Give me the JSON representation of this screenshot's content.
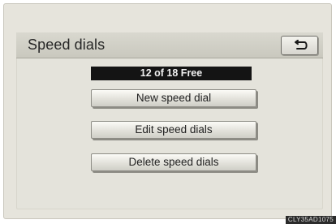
{
  "window": {
    "title": "Speed dials",
    "back_icon": "back-arrow-icon"
  },
  "status": {
    "text": "12 of 18 Free"
  },
  "menu": {
    "new_label": "New speed dial",
    "edit_label": "Edit speed dials",
    "delete_label": "Delete speed dials"
  },
  "footer": {
    "code": "CLY35AD1075"
  },
  "colors": {
    "screen_bg": "#e4e3db",
    "status_bg": "#141414",
    "status_text": "#f0f0f0"
  }
}
